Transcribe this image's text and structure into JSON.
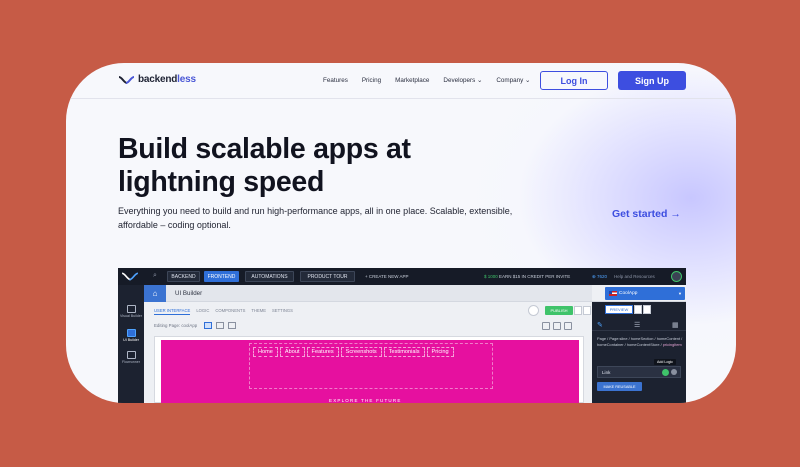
{
  "brand": {
    "name_part1": "backend",
    "name_part2": "less"
  },
  "nav": {
    "items": [
      {
        "label": "Features"
      },
      {
        "label": "Pricing"
      },
      {
        "label": "Marketplace"
      },
      {
        "label": "Developers ⌄"
      },
      {
        "label": "Company ⌄"
      }
    ],
    "login_label": "Log In",
    "signup_label": "Sign Up"
  },
  "hero": {
    "title_line1": "Build scalable apps at",
    "title_line2": "lightning speed",
    "subtitle": "Everything you need to build and run high-performance apps, all in one place. Scalable, extensible, affordable – coding optional.",
    "cta": "Get started →"
  },
  "app": {
    "topbar": {
      "buttons": [
        "BACKEND",
        "FRONTEND",
        "AUTOMATIONS",
        "PRODUCT TOUR"
      ],
      "active_button": "FRONTEND",
      "create_app": "+ CREATE NEW APP",
      "credits_amount": "$ 1000",
      "credits_text": "EARN $15 IN CREDIT PER INVITE",
      "credits_points": "⊕ 7620",
      "help": "Help and Resources"
    },
    "leftbar": [
      {
        "label": "Visual Builder"
      },
      {
        "label": "UI Builder"
      },
      {
        "label": "Flowrunner"
      }
    ],
    "builder": {
      "title": "UI Builder",
      "tabs": [
        "USER INTERFACE",
        "LOGIC",
        "COMPONENTS",
        "THEME",
        "SETTINGS"
      ],
      "editing_page": "Editing Page: coolApp",
      "publish": "PUBLISH",
      "site_nav": [
        "Home",
        "About",
        "Features",
        "Screenshots",
        "Testimonials",
        "Pricing"
      ],
      "explore": "EXPLORE THE FUTURE"
    },
    "panel": {
      "app_name": "CoolApp",
      "preview": "PREVIEW",
      "breadcrumb": "Page / Page:sline / homeSection / homeContent / homeContainer / homeContentStore /",
      "breadcrumb_hl": "pricingItem",
      "tooltip": "Add Logic",
      "field": "Link",
      "make_reusable": "MAKE REUSABLE"
    }
  },
  "colors": {
    "accent": "#3d4ee0",
    "outer_bg": "#c65b46",
    "canvas_pink": "#e6109f"
  }
}
